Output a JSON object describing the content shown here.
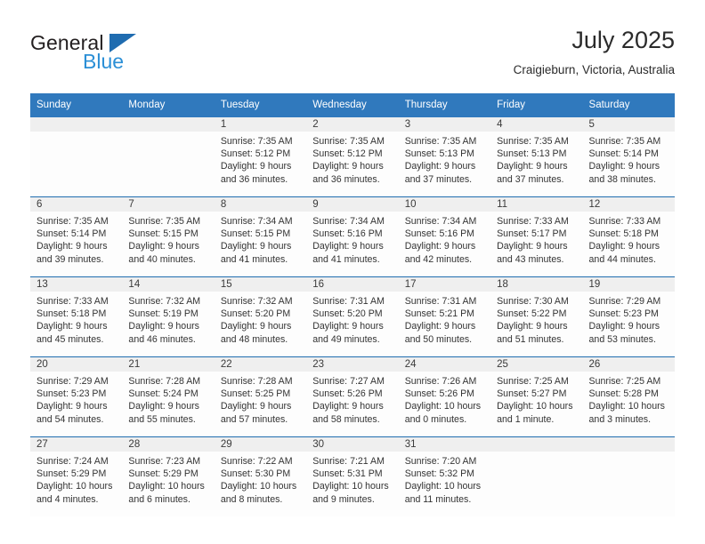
{
  "brand": {
    "name_part1": "General",
    "name_part2": "Blue",
    "accent_color": "#2b8fd6",
    "triangle_color": "#1f6cb0"
  },
  "header": {
    "title": "July 2025",
    "subtitle": "Craigieburn, Victoria, Australia"
  },
  "theme": {
    "header_bg": "#3079bd",
    "row_rule": "#1f6cb0",
    "daynum_band": "#efefef"
  },
  "weekday_headers": [
    "Sunday",
    "Monday",
    "Tuesday",
    "Wednesday",
    "Thursday",
    "Friday",
    "Saturday"
  ],
  "weeks": [
    [
      {
        "day": "",
        "sunrise": "",
        "sunset": "",
        "daylight_line1": "",
        "daylight_line2": "",
        "blank": true
      },
      {
        "day": "",
        "sunrise": "",
        "sunset": "",
        "daylight_line1": "",
        "daylight_line2": "",
        "blank": true
      },
      {
        "day": "1",
        "sunrise": "Sunrise: 7:35 AM",
        "sunset": "Sunset: 5:12 PM",
        "daylight_line1": "Daylight: 9 hours",
        "daylight_line2": "and 36 minutes."
      },
      {
        "day": "2",
        "sunrise": "Sunrise: 7:35 AM",
        "sunset": "Sunset: 5:12 PM",
        "daylight_line1": "Daylight: 9 hours",
        "daylight_line2": "and 36 minutes."
      },
      {
        "day": "3",
        "sunrise": "Sunrise: 7:35 AM",
        "sunset": "Sunset: 5:13 PM",
        "daylight_line1": "Daylight: 9 hours",
        "daylight_line2": "and 37 minutes."
      },
      {
        "day": "4",
        "sunrise": "Sunrise: 7:35 AM",
        "sunset": "Sunset: 5:13 PM",
        "daylight_line1": "Daylight: 9 hours",
        "daylight_line2": "and 37 minutes."
      },
      {
        "day": "5",
        "sunrise": "Sunrise: 7:35 AM",
        "sunset": "Sunset: 5:14 PM",
        "daylight_line1": "Daylight: 9 hours",
        "daylight_line2": "and 38 minutes."
      }
    ],
    [
      {
        "day": "6",
        "sunrise": "Sunrise: 7:35 AM",
        "sunset": "Sunset: 5:14 PM",
        "daylight_line1": "Daylight: 9 hours",
        "daylight_line2": "and 39 minutes."
      },
      {
        "day": "7",
        "sunrise": "Sunrise: 7:35 AM",
        "sunset": "Sunset: 5:15 PM",
        "daylight_line1": "Daylight: 9 hours",
        "daylight_line2": "and 40 minutes."
      },
      {
        "day": "8",
        "sunrise": "Sunrise: 7:34 AM",
        "sunset": "Sunset: 5:15 PM",
        "daylight_line1": "Daylight: 9 hours",
        "daylight_line2": "and 41 minutes."
      },
      {
        "day": "9",
        "sunrise": "Sunrise: 7:34 AM",
        "sunset": "Sunset: 5:16 PM",
        "daylight_line1": "Daylight: 9 hours",
        "daylight_line2": "and 41 minutes."
      },
      {
        "day": "10",
        "sunrise": "Sunrise: 7:34 AM",
        "sunset": "Sunset: 5:16 PM",
        "daylight_line1": "Daylight: 9 hours",
        "daylight_line2": "and 42 minutes."
      },
      {
        "day": "11",
        "sunrise": "Sunrise: 7:33 AM",
        "sunset": "Sunset: 5:17 PM",
        "daylight_line1": "Daylight: 9 hours",
        "daylight_line2": "and 43 minutes."
      },
      {
        "day": "12",
        "sunrise": "Sunrise: 7:33 AM",
        "sunset": "Sunset: 5:18 PM",
        "daylight_line1": "Daylight: 9 hours",
        "daylight_line2": "and 44 minutes."
      }
    ],
    [
      {
        "day": "13",
        "sunrise": "Sunrise: 7:33 AM",
        "sunset": "Sunset: 5:18 PM",
        "daylight_line1": "Daylight: 9 hours",
        "daylight_line2": "and 45 minutes."
      },
      {
        "day": "14",
        "sunrise": "Sunrise: 7:32 AM",
        "sunset": "Sunset: 5:19 PM",
        "daylight_line1": "Daylight: 9 hours",
        "daylight_line2": "and 46 minutes."
      },
      {
        "day": "15",
        "sunrise": "Sunrise: 7:32 AM",
        "sunset": "Sunset: 5:20 PM",
        "daylight_line1": "Daylight: 9 hours",
        "daylight_line2": "and 48 minutes."
      },
      {
        "day": "16",
        "sunrise": "Sunrise: 7:31 AM",
        "sunset": "Sunset: 5:20 PM",
        "daylight_line1": "Daylight: 9 hours",
        "daylight_line2": "and 49 minutes."
      },
      {
        "day": "17",
        "sunrise": "Sunrise: 7:31 AM",
        "sunset": "Sunset: 5:21 PM",
        "daylight_line1": "Daylight: 9 hours",
        "daylight_line2": "and 50 minutes."
      },
      {
        "day": "18",
        "sunrise": "Sunrise: 7:30 AM",
        "sunset": "Sunset: 5:22 PM",
        "daylight_line1": "Daylight: 9 hours",
        "daylight_line2": "and 51 minutes."
      },
      {
        "day": "19",
        "sunrise": "Sunrise: 7:29 AM",
        "sunset": "Sunset: 5:23 PM",
        "daylight_line1": "Daylight: 9 hours",
        "daylight_line2": "and 53 minutes."
      }
    ],
    [
      {
        "day": "20",
        "sunrise": "Sunrise: 7:29 AM",
        "sunset": "Sunset: 5:23 PM",
        "daylight_line1": "Daylight: 9 hours",
        "daylight_line2": "and 54 minutes."
      },
      {
        "day": "21",
        "sunrise": "Sunrise: 7:28 AM",
        "sunset": "Sunset: 5:24 PM",
        "daylight_line1": "Daylight: 9 hours",
        "daylight_line2": "and 55 minutes."
      },
      {
        "day": "22",
        "sunrise": "Sunrise: 7:28 AM",
        "sunset": "Sunset: 5:25 PM",
        "daylight_line1": "Daylight: 9 hours",
        "daylight_line2": "and 57 minutes."
      },
      {
        "day": "23",
        "sunrise": "Sunrise: 7:27 AM",
        "sunset": "Sunset: 5:26 PM",
        "daylight_line1": "Daylight: 9 hours",
        "daylight_line2": "and 58 minutes."
      },
      {
        "day": "24",
        "sunrise": "Sunrise: 7:26 AM",
        "sunset": "Sunset: 5:26 PM",
        "daylight_line1": "Daylight: 10 hours",
        "daylight_line2": "and 0 minutes."
      },
      {
        "day": "25",
        "sunrise": "Sunrise: 7:25 AM",
        "sunset": "Sunset: 5:27 PM",
        "daylight_line1": "Daylight: 10 hours",
        "daylight_line2": "and 1 minute."
      },
      {
        "day": "26",
        "sunrise": "Sunrise: 7:25 AM",
        "sunset": "Sunset: 5:28 PM",
        "daylight_line1": "Daylight: 10 hours",
        "daylight_line2": "and 3 minutes."
      }
    ],
    [
      {
        "day": "27",
        "sunrise": "Sunrise: 7:24 AM",
        "sunset": "Sunset: 5:29 PM",
        "daylight_line1": "Daylight: 10 hours",
        "daylight_line2": "and 4 minutes."
      },
      {
        "day": "28",
        "sunrise": "Sunrise: 7:23 AM",
        "sunset": "Sunset: 5:29 PM",
        "daylight_line1": "Daylight: 10 hours",
        "daylight_line2": "and 6 minutes."
      },
      {
        "day": "29",
        "sunrise": "Sunrise: 7:22 AM",
        "sunset": "Sunset: 5:30 PM",
        "daylight_line1": "Daylight: 10 hours",
        "daylight_line2": "and 8 minutes."
      },
      {
        "day": "30",
        "sunrise": "Sunrise: 7:21 AM",
        "sunset": "Sunset: 5:31 PM",
        "daylight_line1": "Daylight: 10 hours",
        "daylight_line2": "and 9 minutes."
      },
      {
        "day": "31",
        "sunrise": "Sunrise: 7:20 AM",
        "sunset": "Sunset: 5:32 PM",
        "daylight_line1": "Daylight: 10 hours",
        "daylight_line2": "and 11 minutes."
      },
      {
        "day": "",
        "sunrise": "",
        "sunset": "",
        "daylight_line1": "",
        "daylight_line2": "",
        "blank": true
      },
      {
        "day": "",
        "sunrise": "",
        "sunset": "",
        "daylight_line1": "",
        "daylight_line2": "",
        "blank": true
      }
    ]
  ]
}
